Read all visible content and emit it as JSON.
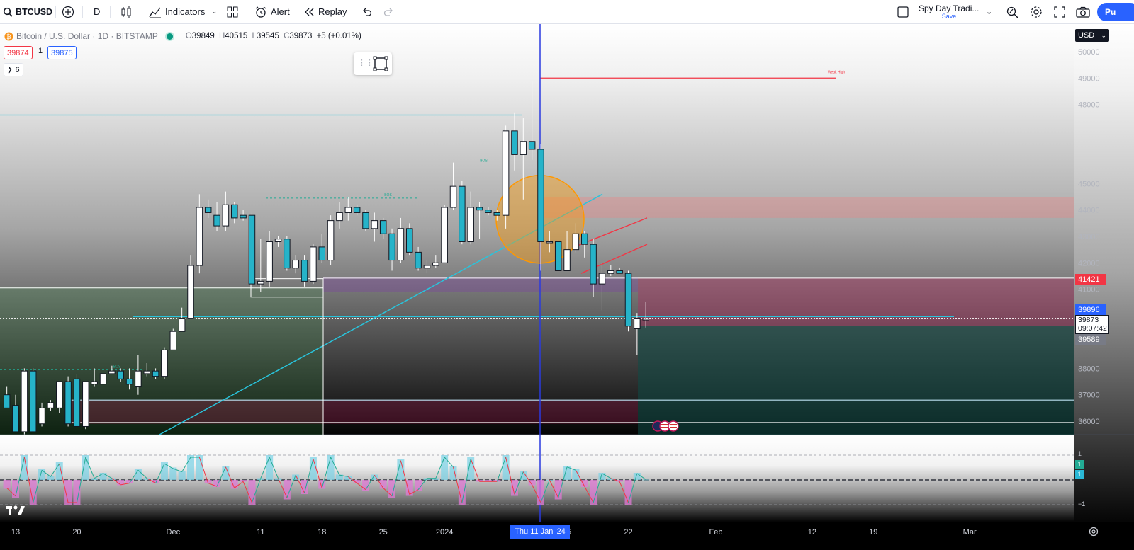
{
  "toolbar": {
    "symbol": "BTCUSD",
    "interval": "D",
    "indicators_label": "Indicators",
    "alert_label": "Alert",
    "replay_label": "Replay",
    "layout_name": "Spy Day Tradi...",
    "layout_save": "Save",
    "publish_label": "Pu"
  },
  "legend": {
    "title": "Bitcoin / U.S. Dollar · 1D · BITSTAMP",
    "o_label": "O",
    "o": "39849",
    "h_label": "H",
    "h": "40515",
    "l_label": "L",
    "l": "39545",
    "c_label": "C",
    "c": "39873",
    "change": "+5 (+0.01%)",
    "bid": "39874",
    "spread": "1",
    "ask": "39875",
    "indicator_count": "6"
  },
  "price_axis": {
    "currency": "USD",
    "tags": {
      "level_red": "41421",
      "level_blue": "39896",
      "last_price": "39873",
      "countdown": "09:07:42",
      "level_gray": "39589"
    },
    "osc_tags": [
      "1",
      "1"
    ],
    "osc_tick_top": "1",
    "osc_tick_bottom": "−1"
  },
  "annotations": {
    "weak_high": "Weak High",
    "bos_labels": [
      "BOS",
      "BOS",
      "BOS"
    ]
  },
  "colors": {
    "up_body": "#ffffff",
    "down_body": "#26b3c9",
    "candle_border": "#131722",
    "trendline": "#29c4dc",
    "cursor_line": "#2a3ae0",
    "weak_high_line": "#f23645",
    "orange_circle": "#ff9800"
  },
  "chart_data": {
    "type": "candlestick",
    "symbol": "BTCUSD",
    "interval": "1D",
    "ylim": [
      35600,
      50600
    ],
    "y_ticks": [
      36000,
      37000,
      38000,
      39000,
      40000,
      41000,
      42000,
      43000,
      44000,
      45000,
      46000,
      47000,
      48000,
      49000,
      50000
    ],
    "y_tick_labels": [
      "36000",
      "37000",
      "38000",
      "",
      "",
      "41000",
      "42000",
      "43000",
      "44000",
      "45000",
      "",
      "",
      "48000",
      "49000",
      "50000"
    ],
    "x_labels": [
      {
        "label": "13",
        "date": "2023-11-13"
      },
      {
        "label": "20",
        "date": "2023-11-20"
      },
      {
        "label": "Dec",
        "date": "2023-12-01"
      },
      {
        "label": "11",
        "date": "2023-12-11"
      },
      {
        "label": "18",
        "date": "2023-12-18"
      },
      {
        "label": "25",
        "date": "2023-12-25"
      },
      {
        "label": "2024",
        "date": "2024-01-01"
      },
      {
        "label": "15",
        "date": "2024-01-15"
      },
      {
        "label": "22",
        "date": "2024-01-22"
      },
      {
        "label": "Feb",
        "date": "2024-02-01"
      },
      {
        "label": "12",
        "date": "2024-02-12"
      },
      {
        "label": "19",
        "date": "2024-02-19"
      },
      {
        "label": "Mar",
        "date": "2024-03-01"
      }
    ],
    "crosshair_label": "Thu 11 Jan '24",
    "crosshair_date": "2024-01-11",
    "candles": [
      {
        "date": "2023-11-12",
        "o": 37000,
        "h": 37300,
        "l": 36700,
        "c": 36500
      },
      {
        "date": "2023-11-13",
        "o": 36600,
        "h": 37000,
        "l": 35600,
        "c": 35600
      },
      {
        "date": "2023-11-14",
        "o": 35600,
        "h": 38000,
        "l": 35500,
        "c": 37900
      },
      {
        "date": "2023-11-15",
        "o": 37900,
        "h": 38000,
        "l": 35600,
        "c": 35600
      },
      {
        "date": "2023-11-16",
        "o": 35900,
        "h": 36700,
        "l": 35800,
        "c": 36500
      },
      {
        "date": "2023-11-17",
        "o": 36500,
        "h": 36800,
        "l": 36400,
        "c": 36700
      },
      {
        "date": "2023-11-18",
        "o": 36500,
        "h": 37500,
        "l": 36300,
        "c": 37500
      },
      {
        "date": "2023-11-19",
        "o": 37500,
        "h": 37700,
        "l": 35800,
        "c": 35900
      },
      {
        "date": "2023-11-20",
        "o": 37600,
        "h": 37800,
        "l": 35800,
        "c": 35800
      },
      {
        "date": "2023-11-21",
        "o": 35800,
        "h": 37500,
        "l": 35700,
        "c": 37500
      },
      {
        "date": "2023-11-22",
        "o": 37400,
        "h": 38000,
        "l": 37300,
        "c": 37500
      },
      {
        "date": "2023-11-23",
        "o": 37400,
        "h": 38500,
        "l": 37100,
        "c": 37800
      },
      {
        "date": "2023-11-24",
        "o": 37800,
        "h": 38100,
        "l": 37800,
        "c": 37900
      },
      {
        "date": "2023-11-25",
        "o": 37900,
        "h": 38000,
        "l": 37500,
        "c": 37600
      },
      {
        "date": "2023-11-26",
        "o": 37600,
        "h": 38000,
        "l": 37200,
        "c": 37400
      },
      {
        "date": "2023-11-27",
        "o": 37300,
        "h": 38500,
        "l": 37000,
        "c": 37900
      },
      {
        "date": "2023-11-28",
        "o": 37800,
        "h": 38200,
        "l": 37700,
        "c": 37900
      },
      {
        "date": "2023-11-29",
        "o": 37900,
        "h": 38000,
        "l": 37600,
        "c": 37700
      },
      {
        "date": "2023-11-30",
        "o": 37700,
        "h": 38800,
        "l": 37600,
        "c": 38700
      },
      {
        "date": "2023-12-01",
        "o": 38700,
        "h": 39500,
        "l": 38700,
        "c": 39400
      },
      {
        "date": "2023-12-02",
        "o": 39400,
        "h": 40300,
        "l": 39400,
        "c": 39900
      },
      {
        "date": "2023-12-03",
        "o": 39900,
        "h": 42300,
        "l": 39900,
        "c": 41900
      },
      {
        "date": "2023-12-04",
        "o": 41900,
        "h": 44600,
        "l": 41600,
        "c": 44100
      },
      {
        "date": "2023-12-05",
        "o": 44100,
        "h": 44400,
        "l": 43700,
        "c": 43900
      },
      {
        "date": "2023-12-06",
        "o": 43800,
        "h": 44300,
        "l": 43200,
        "c": 43400
      },
      {
        "date": "2023-12-07",
        "o": 43400,
        "h": 44700,
        "l": 43200,
        "c": 44200
      },
      {
        "date": "2023-12-08",
        "o": 44200,
        "h": 44300,
        "l": 43500,
        "c": 43700
      },
      {
        "date": "2023-12-09",
        "o": 43800,
        "h": 44000,
        "l": 43600,
        "c": 43700
      },
      {
        "date": "2023-12-10",
        "o": 43800,
        "h": 43900,
        "l": 41000,
        "c": 41200
      },
      {
        "date": "2023-12-11",
        "o": 41200,
        "h": 42900,
        "l": 40900,
        "c": 41300
      },
      {
        "date": "2023-12-12",
        "o": 41300,
        "h": 43200,
        "l": 41100,
        "c": 42800
      },
      {
        "date": "2023-12-13",
        "o": 42800,
        "h": 43000,
        "l": 42600,
        "c": 42900
      },
      {
        "date": "2023-12-14",
        "o": 42900,
        "h": 43000,
        "l": 41700,
        "c": 41800
      },
      {
        "date": "2023-12-15",
        "o": 41800,
        "h": 42300,
        "l": 41600,
        "c": 42100
      },
      {
        "date": "2023-12-16",
        "o": 42100,
        "h": 42300,
        "l": 41100,
        "c": 41300
      },
      {
        "date": "2023-12-17",
        "o": 41300,
        "h": 42700,
        "l": 41200,
        "c": 42600
      },
      {
        "date": "2023-12-18",
        "o": 42600,
        "h": 43100,
        "l": 42000,
        "c": 42100
      },
      {
        "date": "2023-12-19",
        "o": 42100,
        "h": 43800,
        "l": 41900,
        "c": 43600
      },
      {
        "date": "2023-12-20",
        "o": 43600,
        "h": 44300,
        "l": 43300,
        "c": 43900
      },
      {
        "date": "2023-12-21",
        "o": 43900,
        "h": 44500,
        "l": 43600,
        "c": 44100
      },
      {
        "date": "2023-12-22",
        "o": 44100,
        "h": 44200,
        "l": 43800,
        "c": 43900
      },
      {
        "date": "2023-12-23",
        "o": 43900,
        "h": 44000,
        "l": 43200,
        "c": 43300
      },
      {
        "date": "2023-12-24",
        "o": 43300,
        "h": 43900,
        "l": 42800,
        "c": 43600
      },
      {
        "date": "2023-12-25",
        "o": 43600,
        "h": 43700,
        "l": 42900,
        "c": 43100
      },
      {
        "date": "2023-12-26",
        "o": 43100,
        "h": 43300,
        "l": 41700,
        "c": 42100
      },
      {
        "date": "2023-12-27",
        "o": 42100,
        "h": 43700,
        "l": 42000,
        "c": 43300
      },
      {
        "date": "2023-12-28",
        "o": 43300,
        "h": 43500,
        "l": 42300,
        "c": 42400
      },
      {
        "date": "2023-12-29",
        "o": 42400,
        "h": 42600,
        "l": 41700,
        "c": 41800
      },
      {
        "date": "2023-12-30",
        "o": 41800,
        "h": 42100,
        "l": 41600,
        "c": 41900
      },
      {
        "date": "2023-12-31",
        "o": 41900,
        "h": 42300,
        "l": 41800,
        "c": 42000
      },
      {
        "date": "2024-01-01",
        "o": 42000,
        "h": 44200,
        "l": 42000,
        "c": 44100
      },
      {
        "date": "2024-01-02",
        "o": 44100,
        "h": 45800,
        "l": 44000,
        "c": 44900
      },
      {
        "date": "2024-01-03",
        "o": 44900,
        "h": 45100,
        "l": 42700,
        "c": 42800
      },
      {
        "date": "2024-01-04",
        "o": 42800,
        "h": 44700,
        "l": 42700,
        "c": 44100
      },
      {
        "date": "2024-01-05",
        "o": 44100,
        "h": 44300,
        "l": 42900,
        "c": 44000
      },
      {
        "date": "2024-01-06",
        "o": 44000,
        "h": 44100,
        "l": 43800,
        "c": 43900
      },
      {
        "date": "2024-01-07",
        "o": 43900,
        "h": 44000,
        "l": 43600,
        "c": 43800
      },
      {
        "date": "2024-01-08",
        "o": 43800,
        "h": 47200,
        "l": 43300,
        "c": 47000
      },
      {
        "date": "2024-01-09",
        "o": 47000,
        "h": 47700,
        "l": 45500,
        "c": 46100
      },
      {
        "date": "2024-01-10",
        "o": 46100,
        "h": 47500,
        "l": 44400,
        "c": 46600
      },
      {
        "date": "2024-01-11",
        "o": 46600,
        "h": 48900,
        "l": 45900,
        "c": 46300
      },
      {
        "date": "2024-01-12",
        "o": 46300,
        "h": 46500,
        "l": 41700,
        "c": 42800
      },
      {
        "date": "2024-01-13",
        "o": 42800,
        "h": 43200,
        "l": 42400,
        "c": 42800
      },
      {
        "date": "2024-01-14",
        "o": 42800,
        "h": 42800,
        "l": 41700,
        "c": 41700
      },
      {
        "date": "2024-01-15",
        "o": 41700,
        "h": 43200,
        "l": 41700,
        "c": 42500
      },
      {
        "date": "2024-01-16",
        "o": 42500,
        "h": 43500,
        "l": 42400,
        "c": 43100
      },
      {
        "date": "2024-01-17",
        "o": 43100,
        "h": 43200,
        "l": 42200,
        "c": 42700
      },
      {
        "date": "2024-01-18",
        "o": 42700,
        "h": 42900,
        "l": 40700,
        "c": 41200
      },
      {
        "date": "2024-01-19",
        "o": 41200,
        "h": 42000,
        "l": 40200,
        "c": 41600
      },
      {
        "date": "2024-01-20",
        "o": 41600,
        "h": 41900,
        "l": 41500,
        "c": 41700
      },
      {
        "date": "2024-01-21",
        "o": 41700,
        "h": 41800,
        "l": 41600,
        "c": 41600
      },
      {
        "date": "2024-01-22",
        "o": 41600,
        "h": 41700,
        "l": 39400,
        "c": 39600
      },
      {
        "date": "2024-01-23",
        "o": 39500,
        "h": 40100,
        "l": 38500,
        "c": 39900
      },
      {
        "date": "2024-01-24",
        "o": 39849,
        "h": 40515,
        "l": 39545,
        "c": 39873
      }
    ]
  }
}
